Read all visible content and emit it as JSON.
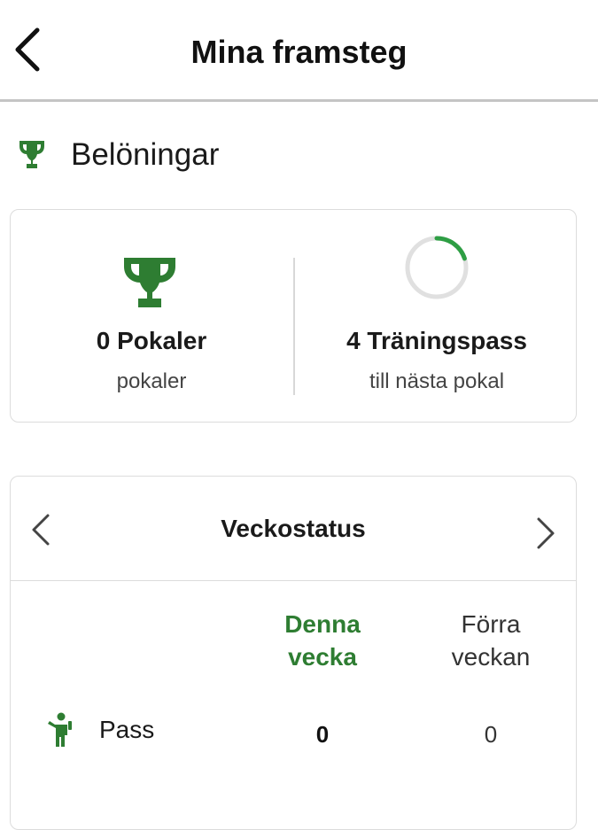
{
  "header": {
    "title": "Mina framsteg"
  },
  "rewards": {
    "heading": "Belöningar",
    "trophies": {
      "count_label": "0 Pokaler",
      "sub_label": "pokaler"
    },
    "next": {
      "count_label": "4 Träningspass",
      "sub_label": "till nästa pokal",
      "progress": 0.2
    }
  },
  "week_status": {
    "title": "Veckostatus",
    "columns": {
      "this_week": "Denna\nvecka",
      "last_week": "Förra\nveckan"
    },
    "rows": [
      {
        "label": "Pass",
        "this_week": "0",
        "last_week": "0"
      }
    ]
  },
  "colors": {
    "accent": "#2e7d32",
    "ring_track": "#e0e0e0",
    "ring_fill": "#2e9e44"
  }
}
